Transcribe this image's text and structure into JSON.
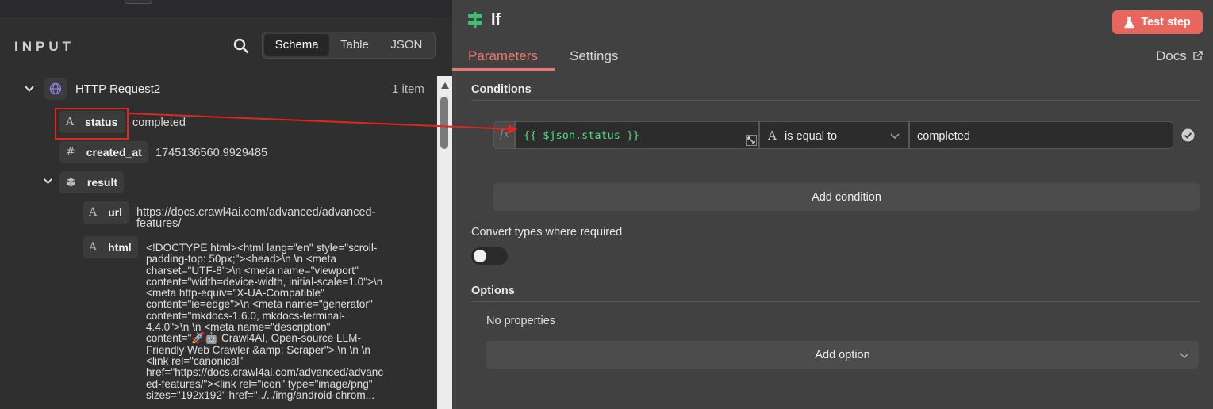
{
  "input_panel": {
    "title": "INPUT",
    "view_tabs": [
      "Schema",
      "Table",
      "JSON"
    ],
    "active_tab": "Schema",
    "node": {
      "name": "HTTP Request2",
      "count": "1 item"
    },
    "fields": {
      "status": {
        "type": "A",
        "key": "status",
        "value": "completed"
      },
      "created_at": {
        "type": "#",
        "key": "created_at",
        "value": "1745136560.9929485"
      },
      "result": {
        "key": "result"
      },
      "url": {
        "type": "A",
        "key": "url",
        "value_line1": "https://docs.crawl4ai.com/advanced/advanced-",
        "value_line2": "features/"
      },
      "html": {
        "type": "A",
        "key": "html",
        "lines": [
          "<!DOCTYPE html><html lang=\"en\" style=\"scroll-",
          "padding-top: 50px;\"><head>\\n \\n <meta",
          "charset=\"UTF-8\">\\n <meta name=\"viewport\"",
          "content=\"width=device-width, initial-scale=1.0\">\\n",
          "<meta http-equiv=\"X-UA-Compatible\"",
          "content=\"ie=edge\">\\n <meta name=\"generator\"",
          "content=\"mkdocs-1.6.0, mkdocs-terminal-",
          "4.4.0\">\\n \\n <meta name=\"description\"",
          "content=\"🚀🤖 Crawl4AI, Open-source LLM-",
          "Friendly Web Crawler &amp; Scraper\"> \\n \\n \\n",
          "<link rel=\"canonical\"",
          "href=\"https://docs.crawl4ai.com/advanced/advanc",
          "ed-features/\"><link rel=\"icon\" type=\"image/png\"",
          "sizes=\"192x192\" href=\"../../img/android-chrom..."
        ]
      }
    }
  },
  "node_panel": {
    "title": "If",
    "test_button": "Test step",
    "tabs": [
      "Parameters",
      "Settings"
    ],
    "active_tab": "Parameters",
    "docs_link": "Docs",
    "conditions_title": "Conditions",
    "condition": {
      "left_value": "{{ $json.status }}",
      "operator_type": "A",
      "operator": "is equal to",
      "right_value": "completed"
    },
    "add_condition": "Add condition",
    "convert_types_label": "Convert types where required",
    "convert_types_enabled": false,
    "options_title": "Options",
    "no_properties": "No properties",
    "add_option": "Add option"
  },
  "colors": {
    "accent": "#f0776f",
    "test_button": "#e9665e",
    "annotation": "#e8231b",
    "expression_text": "#4ee07a"
  }
}
